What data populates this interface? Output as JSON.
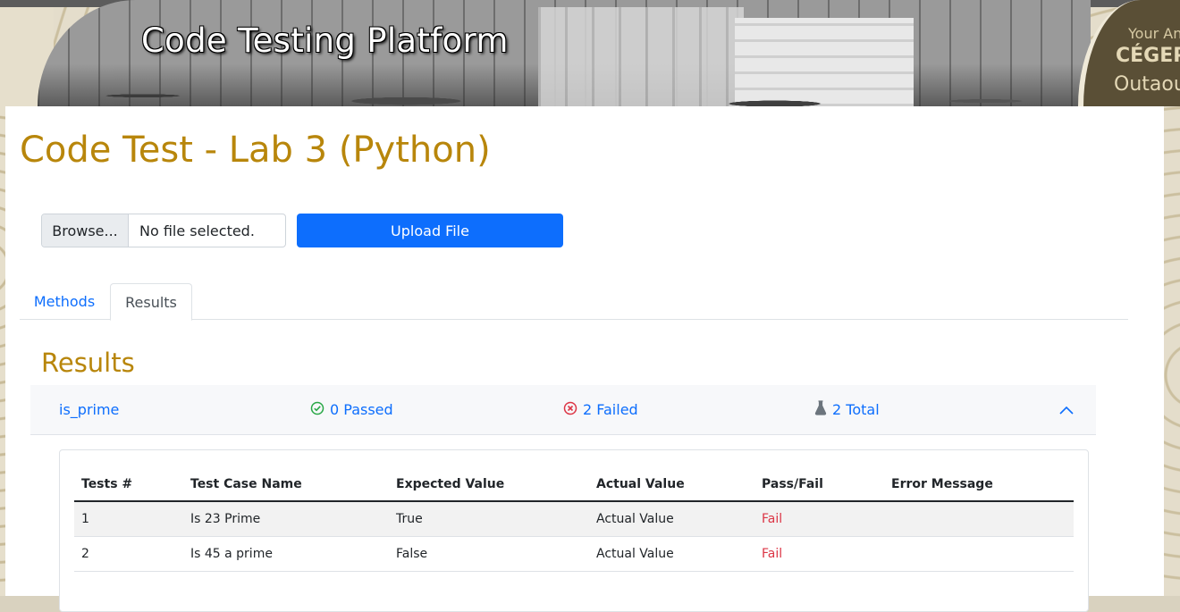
{
  "header": {
    "title": "Code Testing Platform",
    "brand_tagline": "Your Ang",
    "brand_name": "CÉGEP",
    "brand_sub": "Outaou"
  },
  "page": {
    "title": "Code Test - Lab 3 (Python)"
  },
  "upload": {
    "browse_label": "Browse...",
    "file_status": "No file selected.",
    "upload_label": "Upload File"
  },
  "tabs": [
    {
      "label": "Methods",
      "active": false
    },
    {
      "label": "Results",
      "active": true
    }
  ],
  "results": {
    "section_title": "Results",
    "method": {
      "name": "is_prime",
      "passed": "0 Passed",
      "failed": "2 Failed",
      "total": "2 Total",
      "expanded": true
    },
    "table": {
      "headers": [
        "Tests #",
        "Test Case Name",
        "Expected Value",
        "Actual Value",
        "Pass/Fail",
        "Error Message"
      ],
      "rows": [
        [
          "1",
          "Is 23 Prime",
          "True",
          "Actual Value",
          "Fail",
          ""
        ],
        [
          "2",
          "Is 45 a prime",
          "False",
          "Actual Value",
          "Fail",
          ""
        ]
      ]
    }
  },
  "colors": {
    "accent_gold": "#b8860b",
    "primary_blue": "#0d6efd",
    "pass_green": "#28a745",
    "fail_red": "#dc3545",
    "brand_brown": "#5a4f36"
  }
}
